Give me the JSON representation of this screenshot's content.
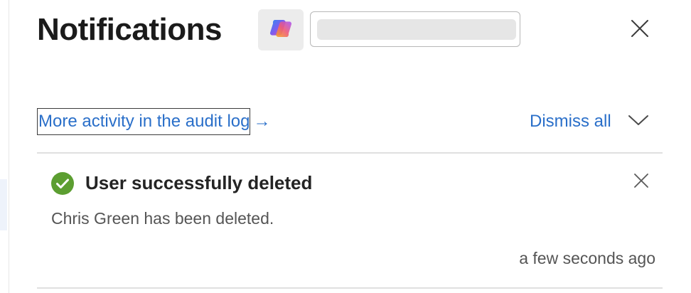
{
  "panel": {
    "title": "Notifications",
    "copilot_icon": "copilot-icon",
    "close_icon": "close-icon"
  },
  "actions": {
    "audit_link_label": "More activity in the audit log",
    "audit_link_arrow": "→",
    "dismiss_all_label": "Dismiss all",
    "expand_icon": "chevron-down-icon"
  },
  "notifications": [
    {
      "status_icon": "success-check-icon",
      "title": "User successfully deleted",
      "message": "Chris Green has been deleted.",
      "timestamp": "a few seconds ago",
      "close_icon": "close-icon"
    }
  ],
  "colors": {
    "link": "#2a6fc9",
    "success": "#5c9e31",
    "title": "#1b1b1b"
  }
}
